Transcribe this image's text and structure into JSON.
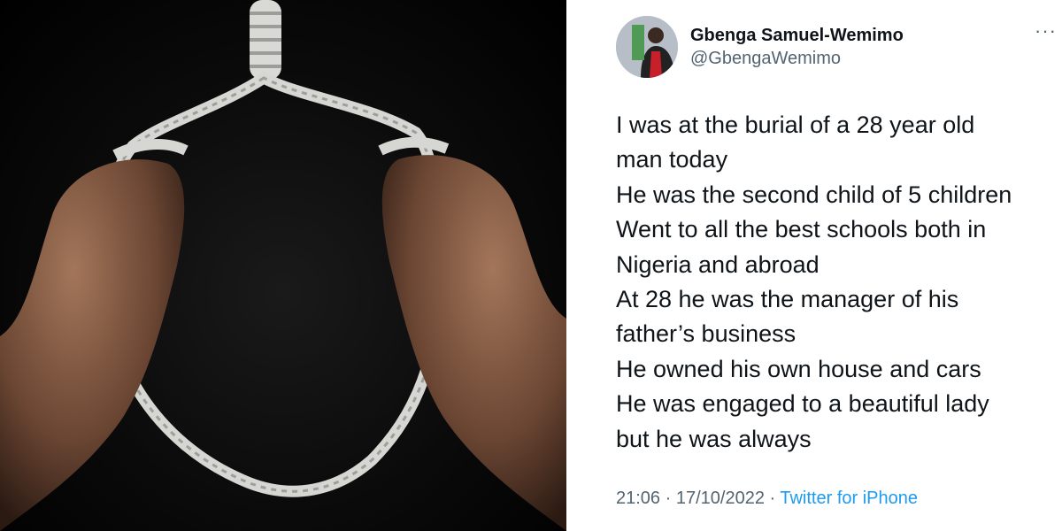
{
  "tweet": {
    "author_name": "Gbenga Samuel-Wemimo",
    "author_handle": "@GbengaWemimo",
    "more_icon": "more-horizontal-icon",
    "lines": [
      "I was at the burial of a 28 year old",
      "man today",
      "He was the second child of 5 children",
      "Went to all the best schools both in",
      "Nigeria and abroad",
      "At 28 he was the manager of his",
      "father’s business",
      "He owned his own house and cars",
      "He was engaged to a beautiful lady",
      "but he was always"
    ],
    "time": "21:06",
    "separator": " · ",
    "date": "17/10/2022",
    "source": "Twitter for iPhone"
  },
  "colors": {
    "text": "#0f1419",
    "muted": "#536471",
    "link": "#1d9bf0"
  }
}
